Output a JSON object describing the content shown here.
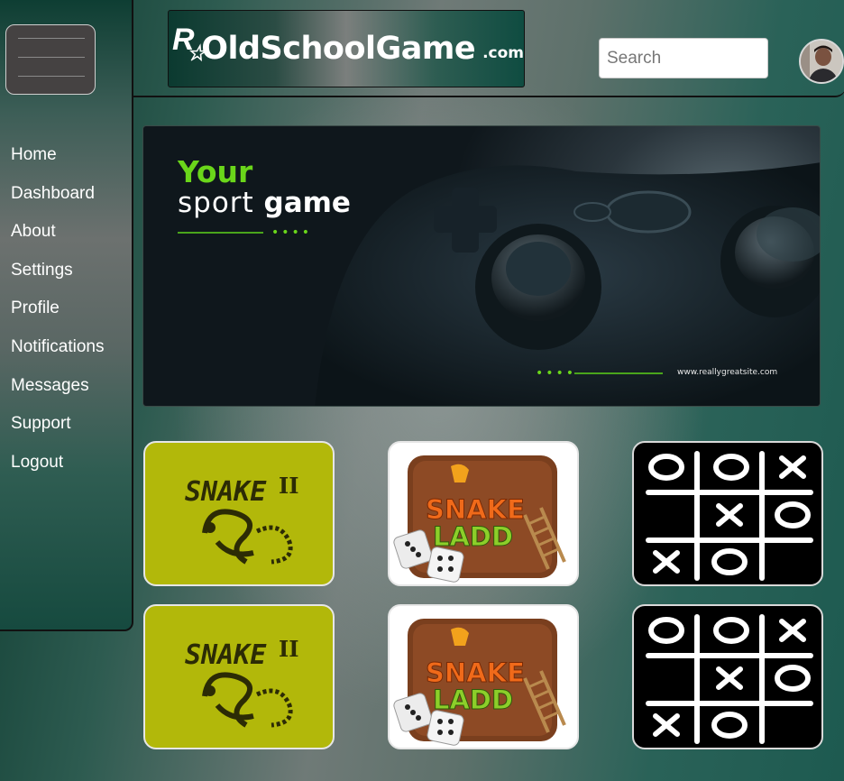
{
  "header": {
    "logo": {
      "mark": "R",
      "star": "☆",
      "name": "OldSchoolGame",
      "suffix": ".com"
    },
    "search": {
      "placeholder": "Search"
    },
    "avatar_icon": "user-avatar-icon"
  },
  "sidebar": {
    "menu_icon": "hamburger-menu-icon",
    "items": [
      {
        "label": "Home"
      },
      {
        "label": "Dashboard"
      },
      {
        "label": "About"
      },
      {
        "label": "Settings"
      },
      {
        "label": "Profile"
      },
      {
        "label": "Notifications"
      },
      {
        "label": "Messages"
      },
      {
        "label": "Support"
      },
      {
        "label": "Logout"
      }
    ]
  },
  "banner": {
    "line1": "Your",
    "line2_a": "sport",
    "line2_b": "game",
    "dots": "••••",
    "url": "www.reallygreatsite.com"
  },
  "games": [
    {
      "title": "SNAKE",
      "roman": "II"
    },
    {
      "title_1": "SNAKE",
      "title_2": "LADD"
    },
    {
      "board": "tic-tac-toe"
    },
    {
      "title": "SNAKE",
      "roman": "II"
    },
    {
      "title_1": "SNAKE",
      "title_2": "LADD"
    },
    {
      "board": "tic-tac-toe"
    }
  ],
  "colors": {
    "accent_green": "#6ad61a",
    "snake_card": "#b2b80a",
    "sidebar_text": "#ffffff"
  }
}
